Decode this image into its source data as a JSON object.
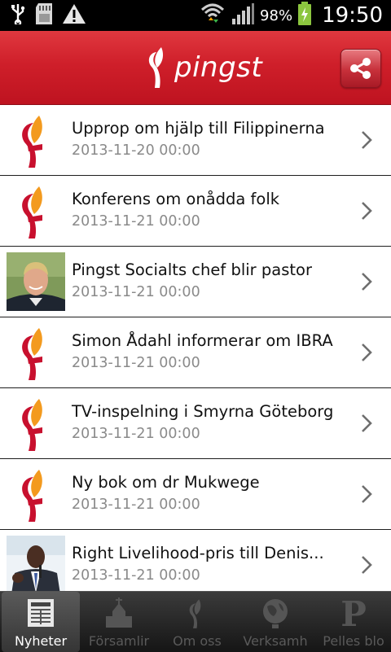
{
  "status_bar": {
    "battery_percent": "98%",
    "time": "19:50",
    "icons": [
      "usb-icon",
      "sd-card-icon",
      "warning-icon",
      "wifi-icon",
      "signal-icon",
      "battery-charging-icon"
    ]
  },
  "header": {
    "brand": "pingst",
    "share_icon": "share-icon"
  },
  "news": [
    {
      "title": "Upprop om hjälp till Filippinerna",
      "date": "2013-11-20 00:00",
      "thumb": "pingst-logo"
    },
    {
      "title": "Konferens om onådda folk",
      "date": "2013-11-21 00:00",
      "thumb": "pingst-logo"
    },
    {
      "title": "Pingst Socialts chef blir pastor",
      "date": "2013-11-21 00:00",
      "thumb": "photo-man"
    },
    {
      "title": "Simon Ådahl informerar om IBRA",
      "date": "2013-11-21 00:00",
      "thumb": "pingst-logo"
    },
    {
      "title": "TV-inspelning i Smyrna Göteborg",
      "date": "2013-11-21 00:00",
      "thumb": "pingst-logo"
    },
    {
      "title": "Ny bok om dr Mukwege",
      "date": "2013-11-21 00:00",
      "thumb": "pingst-logo"
    },
    {
      "title": "Right Livelihood-pris till Denis...",
      "date": "2013-11-21 00:00",
      "thumb": "photo-speaker"
    }
  ],
  "tabs": [
    {
      "label": "Nyheter",
      "icon": "newspaper-icon",
      "active": true
    },
    {
      "label": "Församlir",
      "icon": "church-icon",
      "active": false
    },
    {
      "label": "Om oss",
      "icon": "pingst-icon",
      "active": false
    },
    {
      "label": "Verksamh",
      "icon": "globe-icon",
      "active": false
    },
    {
      "label": "Pelles blo",
      "icon": "letter-p-icon",
      "active": false
    }
  ],
  "colors": {
    "header_red": "#cf1f2a",
    "logo_orange": "#f39a1e",
    "logo_red": "#c8102e",
    "date_gray": "#8a8a8a"
  }
}
